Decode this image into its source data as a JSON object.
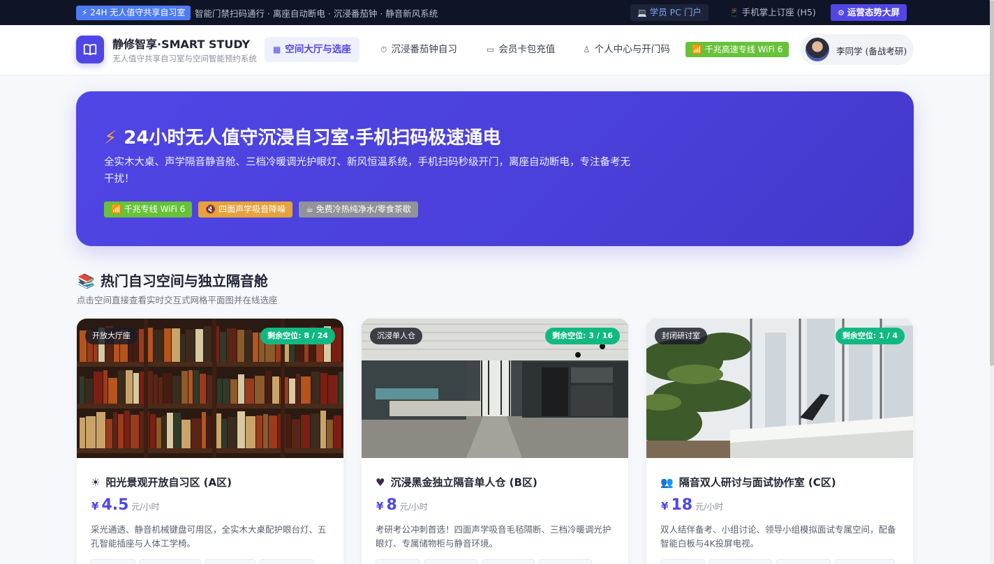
{
  "topbar": {
    "tag": "24H 无人值守共享自习室",
    "ticker": "智能门禁扫码通行 · 离座自动断电 · 沉浸番茄钟 · 静音新风系统",
    "pc_portal": "学员 PC 门户",
    "h5_portal": "手机掌上订座 (H5)",
    "ops_screen": "运营态势大屏"
  },
  "header": {
    "brand_name": "静修智享·SMART STUDY",
    "brand_sub": "无人值守共享自习室与空间智能预约系统",
    "nav": [
      {
        "label": "空间大厅与选座",
        "icon": "grid-icon"
      },
      {
        "label": "沉浸番茄钟自习",
        "icon": "timer-icon"
      },
      {
        "label": "会员卡包充值",
        "icon": "card-icon"
      },
      {
        "label": "个人中心与开门码",
        "icon": "user-icon"
      }
    ],
    "wifi_badge": "千兆高速专线 WiFi 6",
    "user_name": "李同学 (备战考研)"
  },
  "hero": {
    "title": "24小时无人值守沉浸自习室·手机扫码极速通电",
    "description": "全实木大桌、声学隔音静音舱、三档冷暖调光护眼灯、新风恒温系统，手机扫码秒级开门，离座自动断电，专注备考无干扰！",
    "tags": [
      "千兆专线 WiFi 6",
      "四面声学吸音降噪",
      "免费冷热纯净水/零食茶歇"
    ]
  },
  "section": {
    "title": "热门自习空间与独立隔音舱",
    "subtitle": "点击空间直接查看实时交互式网格平面图并在线选座"
  },
  "rooms": [
    {
      "type": "开放大厅座",
      "seats": "剩余空位: 8 / 24",
      "icon": "sun-icon",
      "title": "阳光景观开放自习区 (A区)",
      "currency": "¥",
      "price": "4.5",
      "unit": "元/小时",
      "description": "采光通透、静音机械键盘可用区，全实木大桌配护眼台灯、五孔智能插座与人体工学椅。"
    },
    {
      "type": "沉浸单人仓",
      "seats": "剩余空位: 3 / 16",
      "icon": "heart-icon",
      "title": "沉浸黑金独立隔音单人仓 (B区)",
      "currency": "¥",
      "price": "8",
      "unit": "元/小时",
      "description": "考研考公冲刺首选！四面声学吸音毛毡隔断、三档冷暖调光护眼灯、专属储物柜与静音环境。"
    },
    {
      "type": "封闭研讨室",
      "seats": "剩余空位: 1 / 4",
      "icon": "people-icon",
      "title": "隔音双人研讨与面试协作室 (C区)",
      "currency": "¥",
      "price": "18",
      "unit": "元/小时",
      "description": "双人结伴备考、小组讨论、领导小组模拟面试专属空间，配备智能白板与4K投屏电视。"
    }
  ]
}
